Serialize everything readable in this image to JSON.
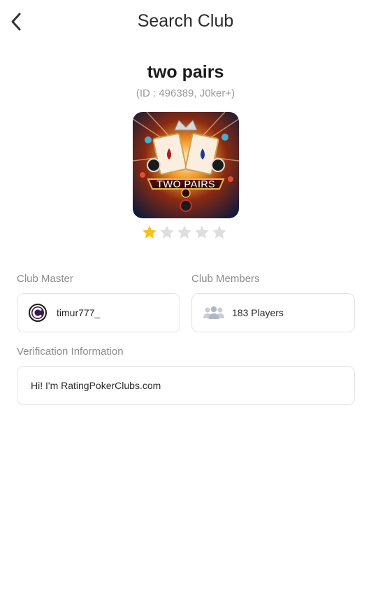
{
  "header": {
    "title": "Search Club"
  },
  "club": {
    "name": "two pairs",
    "id_line": "(ID : 496389, J0ker+)",
    "logo_text": "TWO PAIRS",
    "rating": 1,
    "rating_max": 5
  },
  "master": {
    "label": "Club Master",
    "username": "timur777_"
  },
  "members": {
    "label": "Club Members",
    "count_text": "183 Players"
  },
  "verification": {
    "label": "Verification Information",
    "text": "Hi! I'm RatingPokerClubs.com"
  },
  "colors": {
    "star_filled": "#f8c21c",
    "star_empty": "#dedede",
    "border": "#e3e3e3",
    "label": "#8c8c8c"
  }
}
